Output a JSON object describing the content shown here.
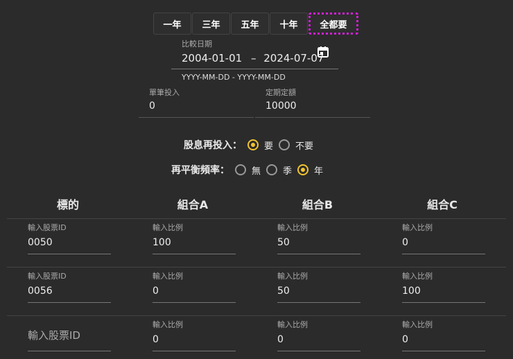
{
  "range_buttons": [
    "一年",
    "三年",
    "五年",
    "十年",
    "全都要"
  ],
  "date": {
    "label": "比較日期",
    "start": "2004-01-01",
    "sep": "–",
    "end": "2024-07-07",
    "hint": "YYYY-MM-DD - YYYY-MM-DD"
  },
  "lump": {
    "label": "單筆投入",
    "value": "0"
  },
  "periodic": {
    "label": "定期定額",
    "value": "10000"
  },
  "dividend": {
    "label": "股息再投入：",
    "options": [
      "要",
      "不要"
    ],
    "selected": 0
  },
  "rebalance": {
    "label": "再平衡頻率：",
    "options": [
      "無",
      "季",
      "年"
    ],
    "selected": 2
  },
  "headers": [
    "標的",
    "組合A",
    "組合B",
    "組合C"
  ],
  "rows": [
    {
      "id_label": "輸入股票ID",
      "id": "0050",
      "ratio_label": "輸入比例",
      "a": "100",
      "b": "50",
      "c": "0"
    },
    {
      "id_label": "輸入股票ID",
      "id": "0056",
      "ratio_label": "輸入比例",
      "a": "0",
      "b": "50",
      "c": "100"
    },
    {
      "id_placeholder": "輸入股票ID",
      "ratio_label": "輸入比例",
      "a": "0",
      "b": "0",
      "c": "0"
    }
  ]
}
